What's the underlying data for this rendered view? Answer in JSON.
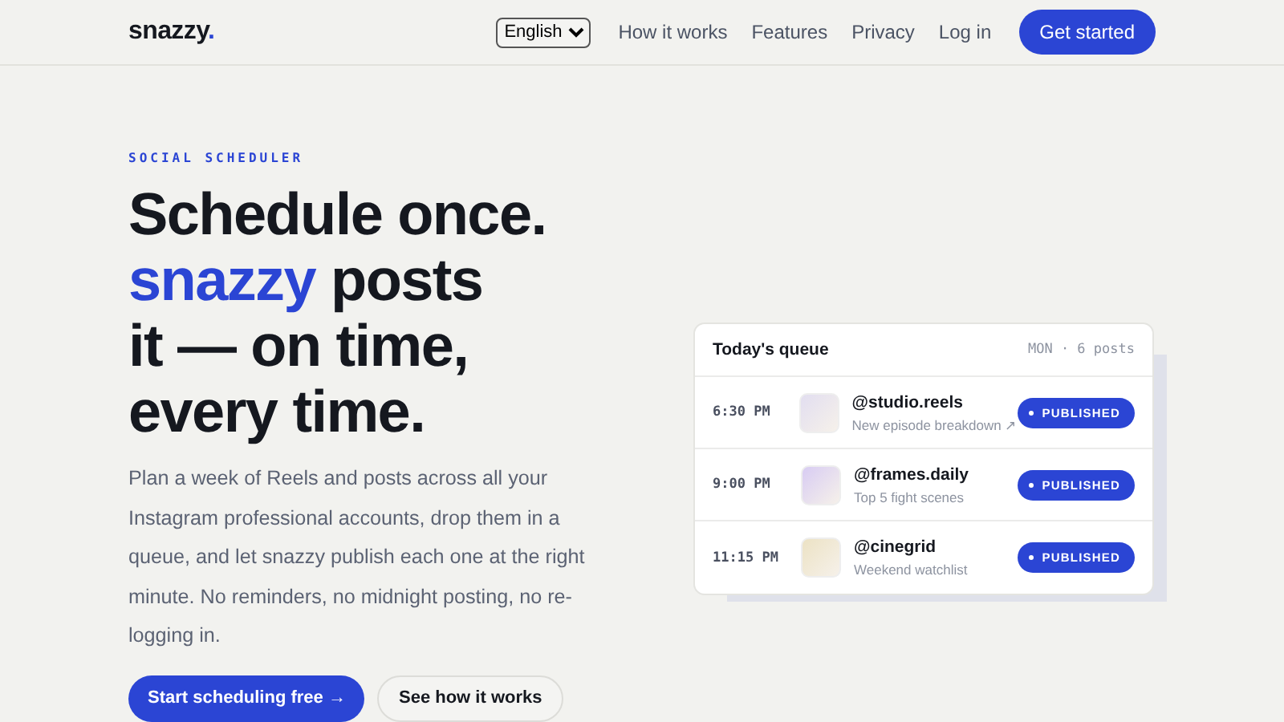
{
  "header": {
    "logo": "snazzy",
    "logo_mark": ".",
    "language": "English",
    "nav": [
      "How it works",
      "Features",
      "Privacy",
      "Log in"
    ],
    "cta": "Get started"
  },
  "hero": {
    "eyebrow": "SOCIAL SCHEDULER",
    "headline_lines": [
      [
        {
          "text": "Schedule once.",
          "accent": false
        }
      ],
      [
        {
          "text": "snazzy",
          "accent": true
        },
        {
          "text": " posts",
          "accent": false
        }
      ],
      [
        {
          "text": "it — on time,",
          "accent": false
        }
      ],
      [
        {
          "text": "every time.",
          "accent": false
        }
      ]
    ],
    "body": "Plan a week of Reels and posts across all your Instagram professional accounts, drop them in a queue, and let snazzy publish each one at the right minute. No reminders, no midnight posting, no re-logging in.",
    "buttons": [
      {
        "label": "Start scheduling free →",
        "kind": "primary"
      },
      {
        "label": "See how it works",
        "kind": "secondary"
      }
    ]
  },
  "queue": {
    "title": "Today's queue",
    "meta": "MON · 6 posts",
    "posts": [
      {
        "time": "6:30 PM",
        "account": "@studio.reels",
        "caption": "New episode breakdown ↗",
        "status": "PUBLISHED",
        "color": "#e2def0"
      },
      {
        "time": "9:00 PM",
        "account": "@frames.daily",
        "caption": "Top 5 fight scenes",
        "status": "PUBLISHED",
        "color": "#d8ccf3"
      },
      {
        "time": "11:15 PM",
        "account": "@cinegrid",
        "caption": "Weekend watchlist",
        "status": "PUBLISHED",
        "color": "#ece2c4"
      }
    ]
  }
}
